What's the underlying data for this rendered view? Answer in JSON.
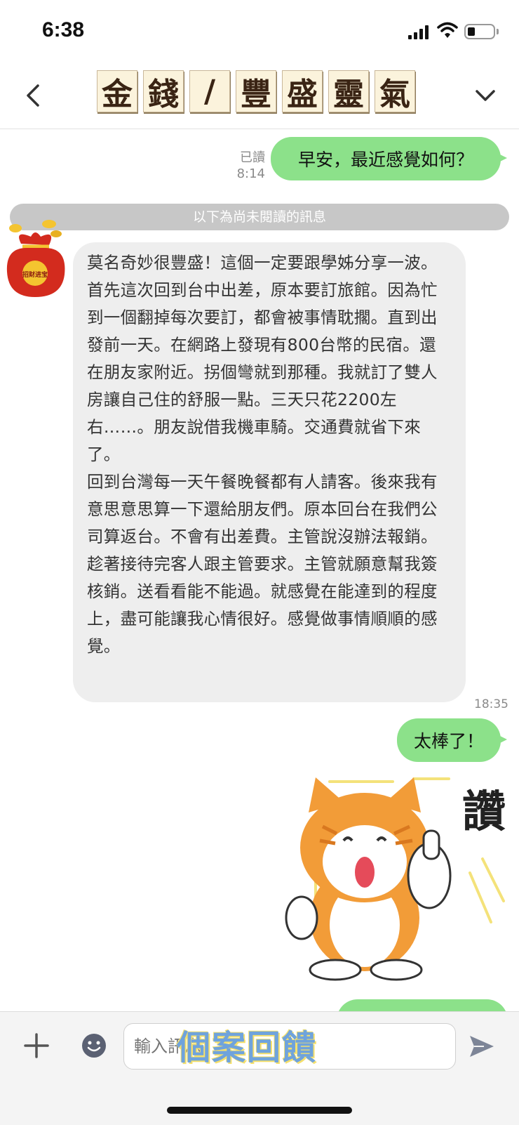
{
  "status_bar": {
    "time": "6:38",
    "battery_level": 0.3
  },
  "header": {
    "title_chars": [
      "金",
      "錢",
      "/",
      "豐",
      "盛",
      "靈",
      "氣"
    ]
  },
  "messages": {
    "outgoing_1": {
      "text": "早安，最近感覺如何？",
      "read_label": "已讀",
      "time": "8:14"
    },
    "unread_divider": "以下為尚未閱讀的訊息",
    "avatar_badge": "招财进宝",
    "incoming_1": {
      "text": "莫名奇妙很豐盛！這個一定要跟學姊分享一波。\n首先這次回到台中出差，原本要訂旅館。因為忙到一個翻掉每次要訂，都會被事情耽擱。直到出發前一天。在網路上發現有800台幣的民宿。還在朋友家附近。拐個彎就到那種。我就訂了雙人房讓自己住的舒服一點。三天只花2200左右……。朋友說借我機車騎。交通費就省下來了。\n回到台灣每一天午餐晚餐都有人請客。後來我有意思意思算一下還給朋友們。原本回台在我們公司算返台。不會有出差費。主管說沒辦法報銷。趁著接待完客人跟主管要求。主管就願意幫我簽核銷。送看看能不能過。就感覺在能達到的程度上，盡可能讓我心情很好。感覺做事情順順的感覺。",
      "time": "18:35"
    },
    "outgoing_2": {
      "text": "太棒了！"
    },
    "sticker_text": "讚"
  },
  "input_bar": {
    "placeholder": "輸入訊息",
    "stamp_text": "個案回饋"
  },
  "colors": {
    "outgoing_bubble": "#8ce18a",
    "incoming_bubble": "#eeeeee",
    "divider": "#c7c7c7"
  }
}
